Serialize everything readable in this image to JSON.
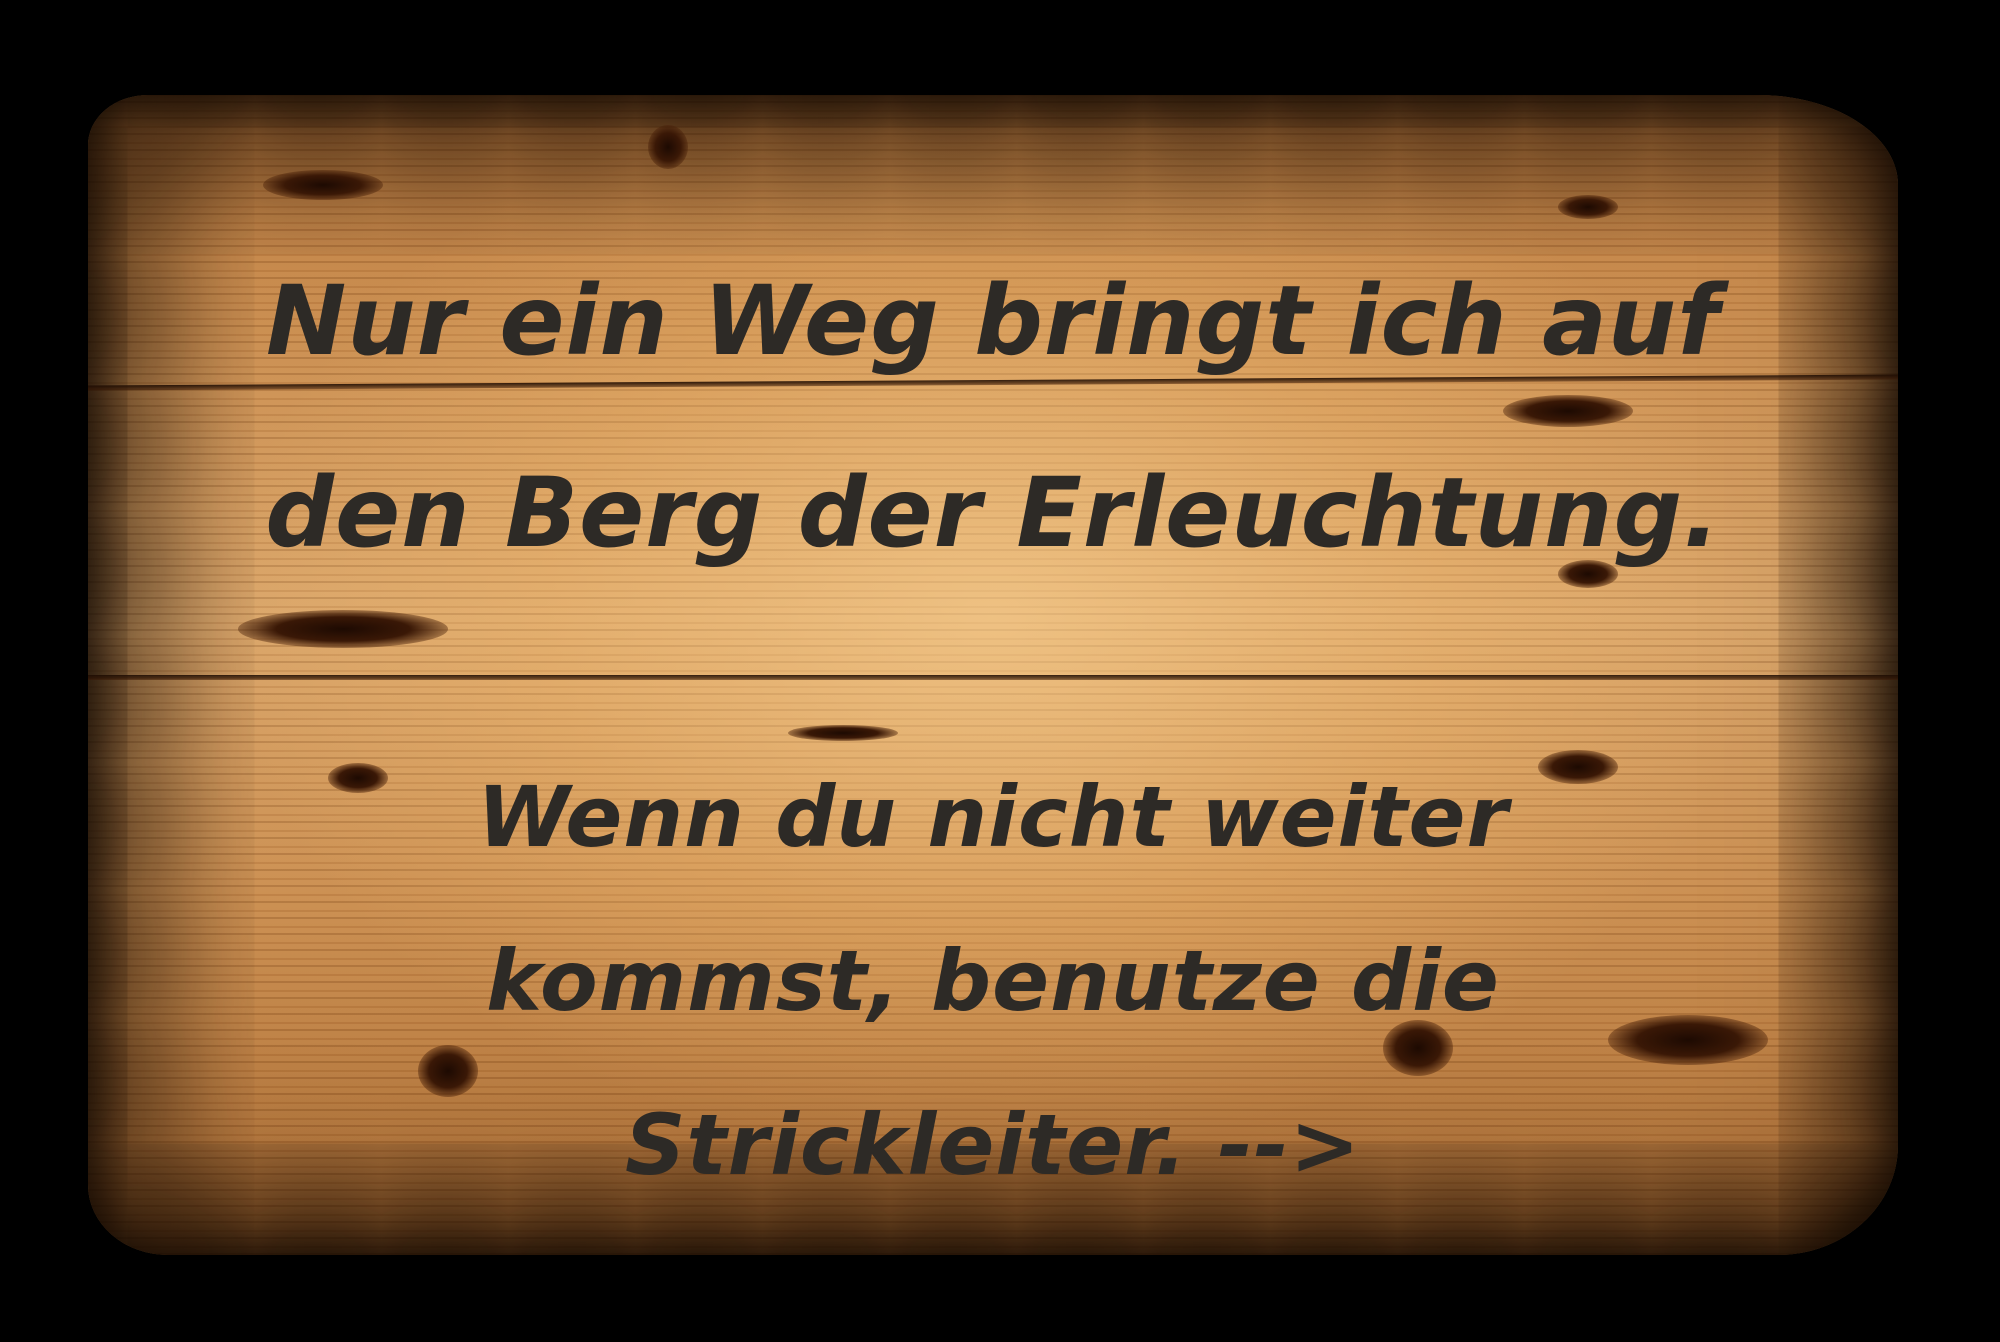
{
  "sign": {
    "quote_lines": [
      "Nur ein Weg bringt ich auf",
      "den Berg der Erleuchtung."
    ],
    "hint_lines": [
      "Wenn du nicht weiter",
      "kommst, benutze die",
      "Strickleiter. -->"
    ]
  },
  "colors": {
    "background": "#000000",
    "wood_light": "#d9a468",
    "wood_dark": "#a96a31",
    "text": "#2d2a26"
  }
}
